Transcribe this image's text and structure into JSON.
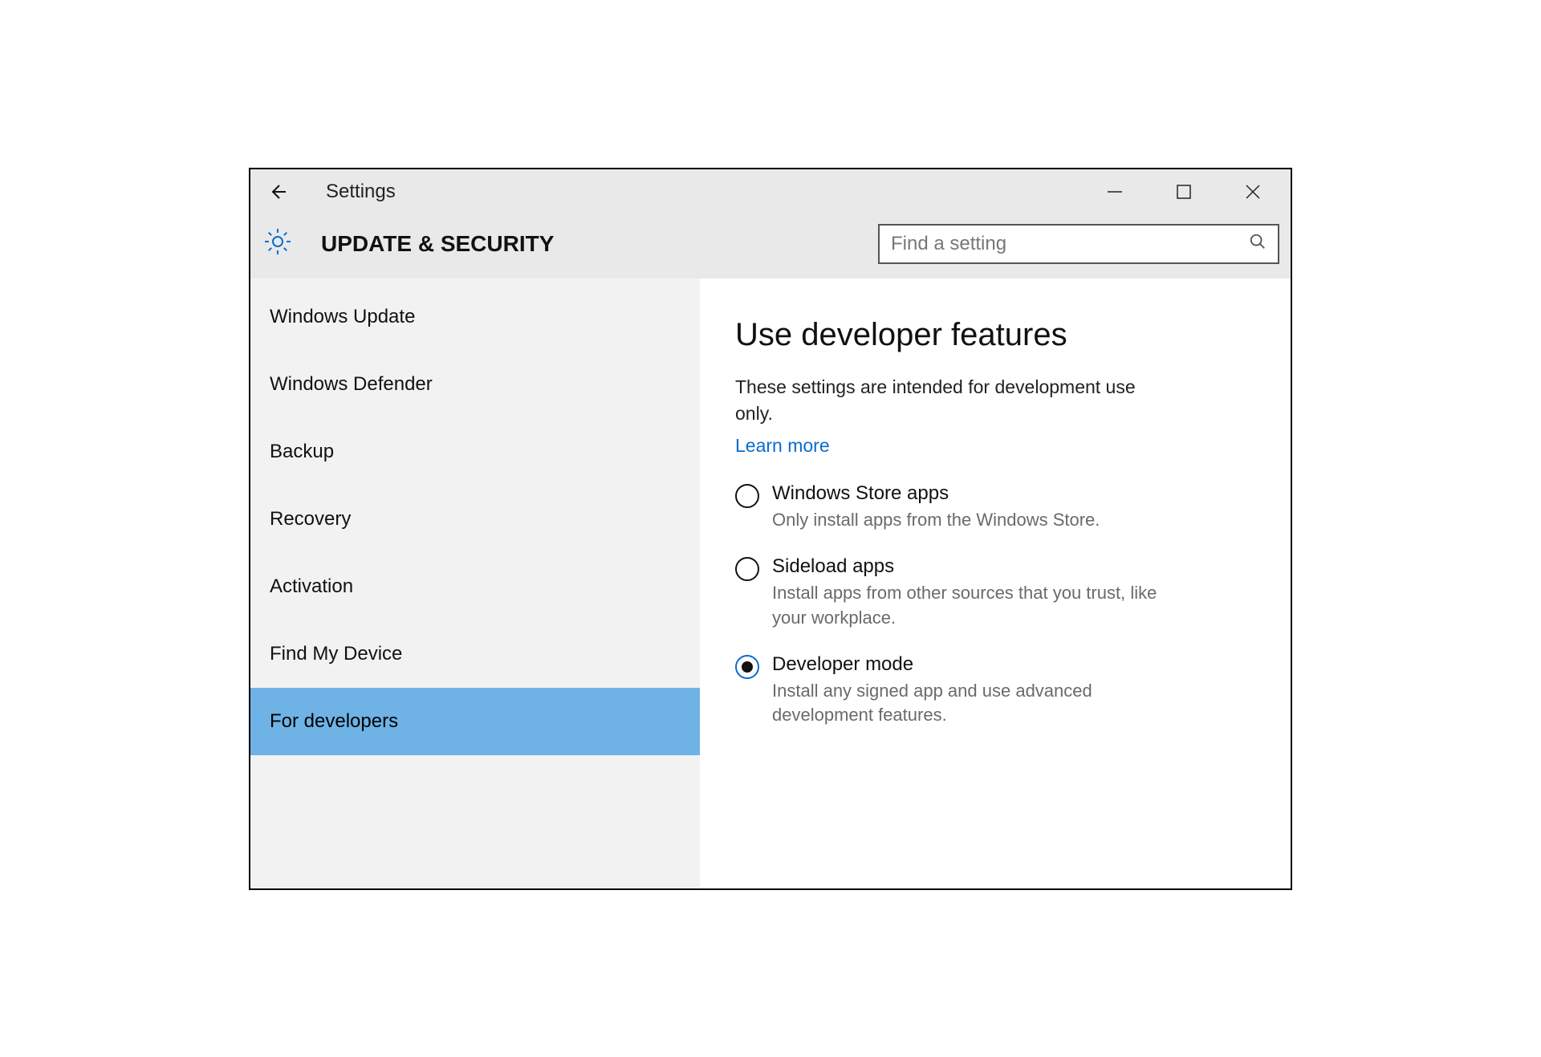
{
  "window": {
    "title": "Settings"
  },
  "header": {
    "section": "UPDATE & SECURITY",
    "search_placeholder": "Find a setting"
  },
  "sidebar": {
    "items": [
      {
        "label": "Windows Update",
        "selected": false
      },
      {
        "label": "Windows Defender",
        "selected": false
      },
      {
        "label": "Backup",
        "selected": false
      },
      {
        "label": "Recovery",
        "selected": false
      },
      {
        "label": "Activation",
        "selected": false
      },
      {
        "label": "Find My Device",
        "selected": false
      },
      {
        "label": "For developers",
        "selected": true
      }
    ]
  },
  "content": {
    "heading": "Use developer features",
    "subtext": "These settings are intended for development use only.",
    "link": "Learn more",
    "options": [
      {
        "label": "Windows Store apps",
        "description": "Only install apps from the Windows Store.",
        "checked": false
      },
      {
        "label": "Sideload apps",
        "description": "Install apps from other sources that you trust, like your workplace.",
        "checked": false
      },
      {
        "label": "Developer mode",
        "description": "Install any signed app and use advanced development features.",
        "checked": true
      }
    ]
  }
}
